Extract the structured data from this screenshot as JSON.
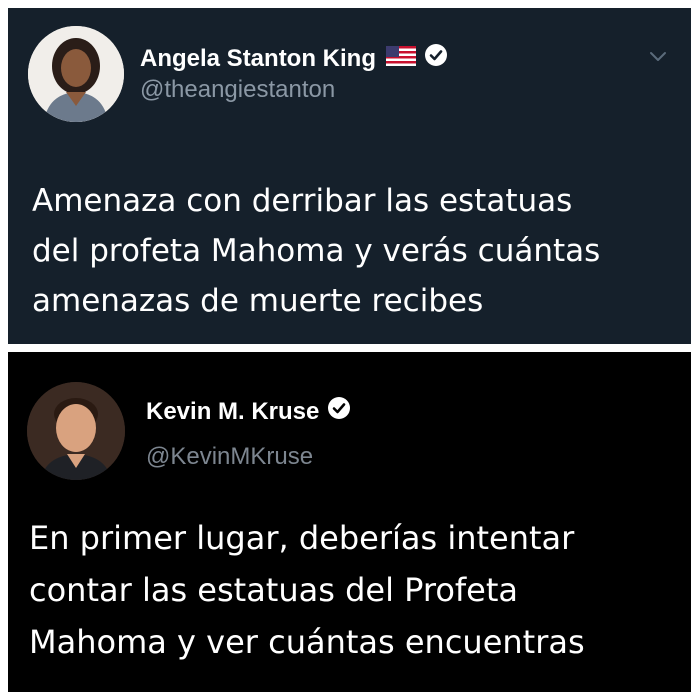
{
  "tweets": [
    {
      "display_name": "Angela Stanton King",
      "handle": "@theangiestanton",
      "flag_icon": "us-flag-icon",
      "verified_icon": "verified-badge-icon",
      "menu_icon": "chevron-down-icon",
      "text": "Amenaza con derribar las estatuas\ndel profeta Mahoma y verás cuántas\namenazas de muerte recibes",
      "background": "#15202b"
    },
    {
      "display_name": "Kevin M. Kruse",
      "handle": "@KevinMKruse",
      "verified_icon": "verified-badge-icon",
      "text": "En primer lugar, deberías intentar\ncontar las estatuas del Profeta\nMahoma y ver cuántas encuentras",
      "background": "#000000"
    }
  ],
  "colors": {
    "handle_gray": "#8b98a5",
    "text_white": "#ffffff",
    "page_background": "#ffffff"
  }
}
